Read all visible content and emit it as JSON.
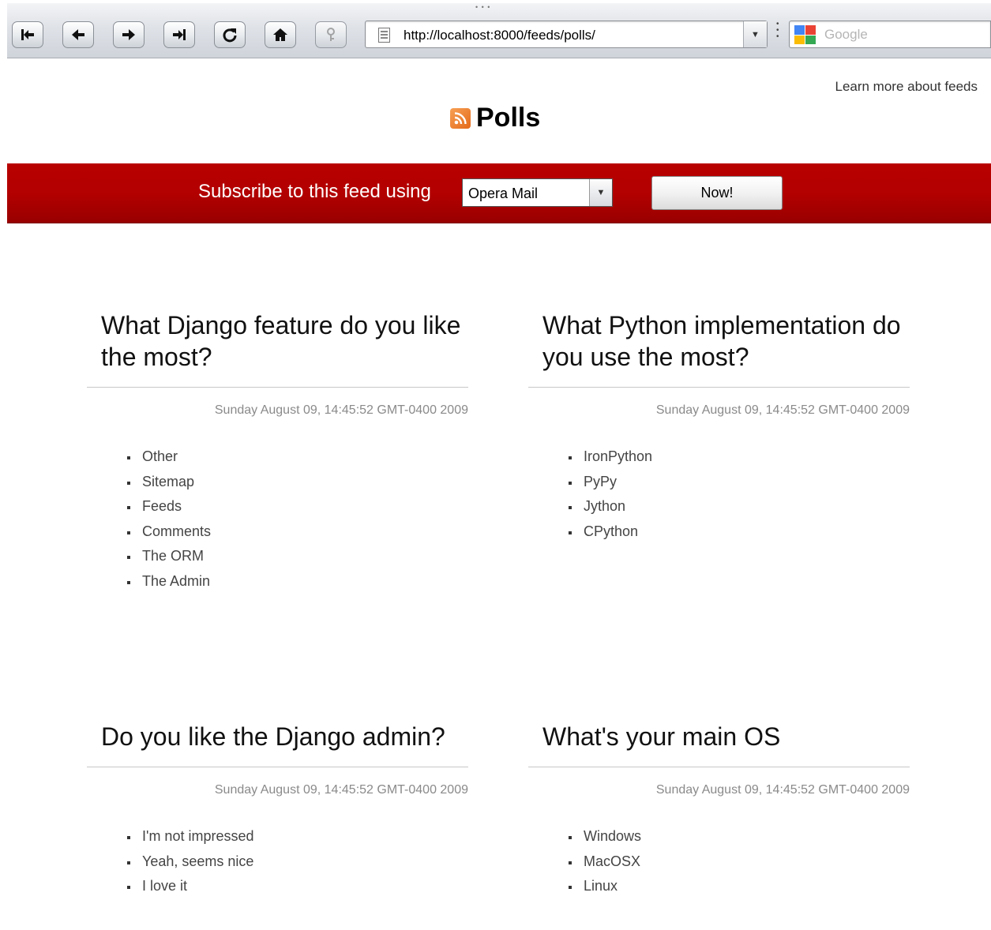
{
  "browser": {
    "url": "http://localhost:8000/feeds/polls/",
    "search_placeholder": "Google",
    "buttons": [
      "rewind-icon",
      "back-icon",
      "forward-icon",
      "fast-forward-icon",
      "reload-icon",
      "home-icon",
      "security-key-icon"
    ]
  },
  "header": {
    "learn_more": "Learn more about feeds",
    "title": "Polls"
  },
  "subscribe": {
    "label": "Subscribe to this feed using",
    "selected": "Opera Mail",
    "button": "Now!"
  },
  "colors": {
    "subscribe_bar": "#b30000",
    "rss_orange": "#e46a1a"
  },
  "polls": [
    {
      "title": "What Django feature do you like the most?",
      "date": "Sunday August 09, 14:45:52 GMT-0400 2009",
      "choices": [
        "Other",
        "Sitemap",
        "Feeds",
        "Comments",
        "The ORM",
        "The Admin"
      ]
    },
    {
      "title": "What Python implementation do you use the most?",
      "date": "Sunday August 09, 14:45:52 GMT-0400 2009",
      "choices": [
        "IronPython",
        "PyPy",
        "Jython",
        "CPython"
      ]
    },
    {
      "title": "Do you like the Django admin?",
      "date": "Sunday August 09, 14:45:52 GMT-0400 2009",
      "choices": [
        "I'm not impressed",
        "Yeah, seems nice",
        "I love it"
      ]
    },
    {
      "title": "What's your main OS",
      "date": "Sunday August 09, 14:45:52 GMT-0400 2009",
      "choices": [
        "Windows",
        "MacOSX",
        "Linux"
      ]
    }
  ]
}
